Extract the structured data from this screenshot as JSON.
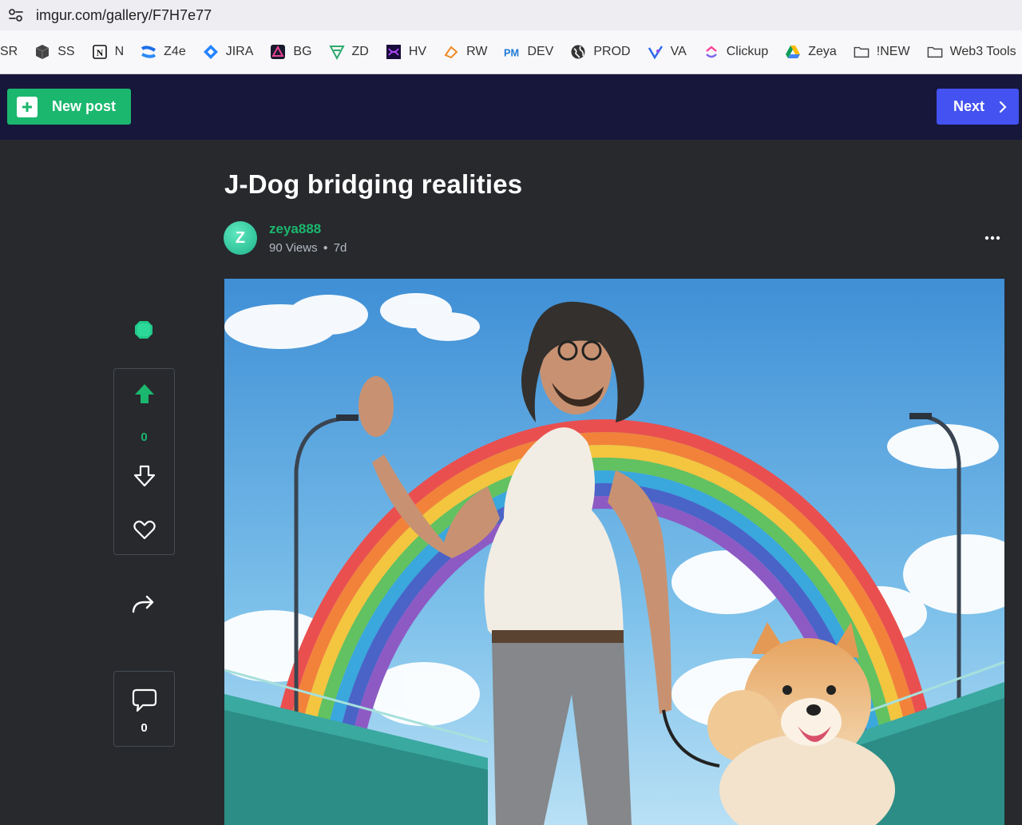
{
  "browser": {
    "url": "imgur.com/gallery/F7H7e77",
    "bookmarks": [
      {
        "label": "SR",
        "icon": "none"
      },
      {
        "label": "SS",
        "icon": "cube-icon"
      },
      {
        "label": "N",
        "icon": "notion-icon"
      },
      {
        "label": "Z4e",
        "icon": "confluence-icon"
      },
      {
        "label": "JIRA",
        "icon": "jira-icon"
      },
      {
        "label": "BG",
        "icon": "bg-icon"
      },
      {
        "label": "ZD",
        "icon": "zd-icon"
      },
      {
        "label": "HV",
        "icon": "hv-icon"
      },
      {
        "label": "RW",
        "icon": "rw-icon"
      },
      {
        "label": "DEV",
        "icon": "pm-icon"
      },
      {
        "label": "PROD",
        "icon": "globe-icon"
      },
      {
        "label": "VA",
        "icon": "va-icon"
      },
      {
        "label": "Clickup",
        "icon": "clickup-icon"
      },
      {
        "label": "Zeya",
        "icon": "google-drive-icon"
      },
      {
        "label": "!NEW",
        "icon": "folder-icon"
      },
      {
        "label": "Web3 Tools",
        "icon": "folder-icon"
      }
    ]
  },
  "header": {
    "new_post_label": "New post",
    "next_label": "Next"
  },
  "post": {
    "title": "J-Dog bridging realities",
    "author": "zeya888",
    "avatar_letter": "Z",
    "views": "90 Views",
    "age": "7d",
    "score": "0",
    "comment_count": "0"
  },
  "colors": {
    "accent_green": "#1bb76e",
    "next_blue": "#4352f0",
    "header_bg": "#17173c",
    "page_bg": "#27292d"
  }
}
